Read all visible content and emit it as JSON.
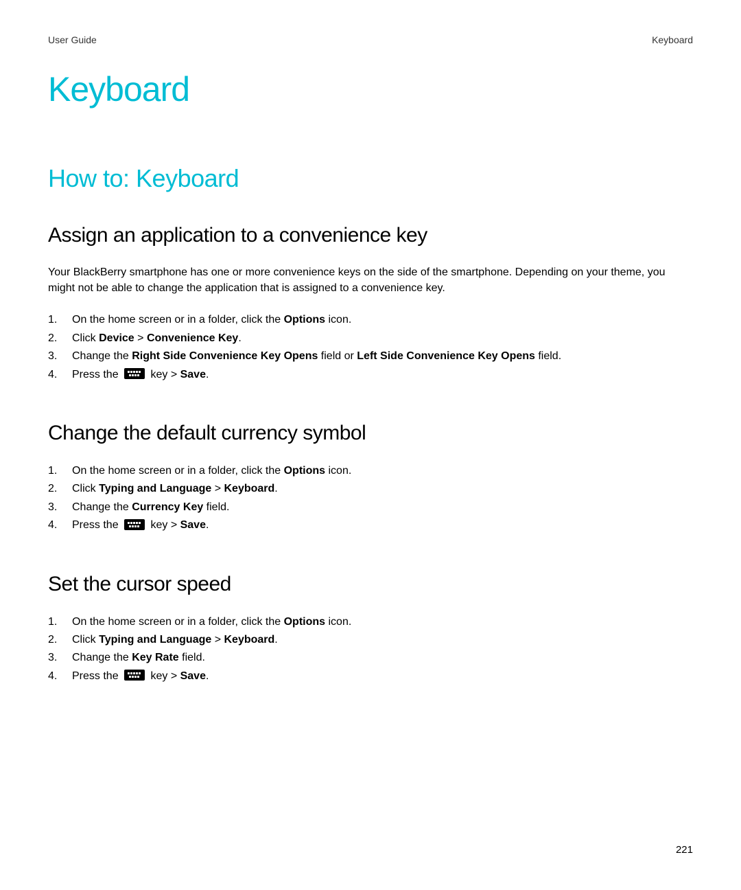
{
  "header": {
    "left": "User Guide",
    "right": "Keyboard"
  },
  "chapter_title": "Keyboard",
  "section_title": "How to: Keyboard",
  "assign": {
    "title": "Assign an application to a convenience key",
    "body": "Your BlackBerry smartphone has one or more convenience keys on the side of the smartphone. Depending on your theme, you might not be able to change the application that is assigned to a convenience key.",
    "step1_a": "On the home screen or in a folder, click the ",
    "step1_b": "Options",
    "step1_c": " icon.",
    "step2_a": "Click ",
    "step2_b": "Device",
    "step2_c": " > ",
    "step2_d": "Convenience Key",
    "step2_e": ".",
    "step3_a": "Change the ",
    "step3_b": "Right Side Convenience Key Opens",
    "step3_c": " field or ",
    "step3_d": "Left Side Convenience Key Opens",
    "step3_e": " field.",
    "step4_a": "Press the ",
    "step4_b": " key > ",
    "step4_c": "Save",
    "step4_d": "."
  },
  "currency": {
    "title": "Change the default currency symbol",
    "step1_a": "On the home screen or in a folder, click the ",
    "step1_b": "Options",
    "step1_c": " icon.",
    "step2_a": "Click ",
    "step2_b": "Typing and Language",
    "step2_c": " > ",
    "step2_d": "Keyboard",
    "step2_e": ".",
    "step3_a": "Change the ",
    "step3_b": "Currency Key",
    "step3_c": " field.",
    "step4_a": "Press the ",
    "step4_b": " key > ",
    "step4_c": "Save",
    "step4_d": "."
  },
  "cursor": {
    "title": "Set the cursor speed",
    "step1_a": "On the home screen or in a folder, click the ",
    "step1_b": "Options",
    "step1_c": " icon.",
    "step2_a": "Click ",
    "step2_b": "Typing and Language",
    "step2_c": " > ",
    "step2_d": "Keyboard",
    "step2_e": ".",
    "step3_a": "Change the ",
    "step3_b": "Key Rate",
    "step3_c": " field.",
    "step4_a": "Press the ",
    "step4_b": " key > ",
    "step4_c": "Save",
    "step4_d": "."
  },
  "page_number": "221"
}
